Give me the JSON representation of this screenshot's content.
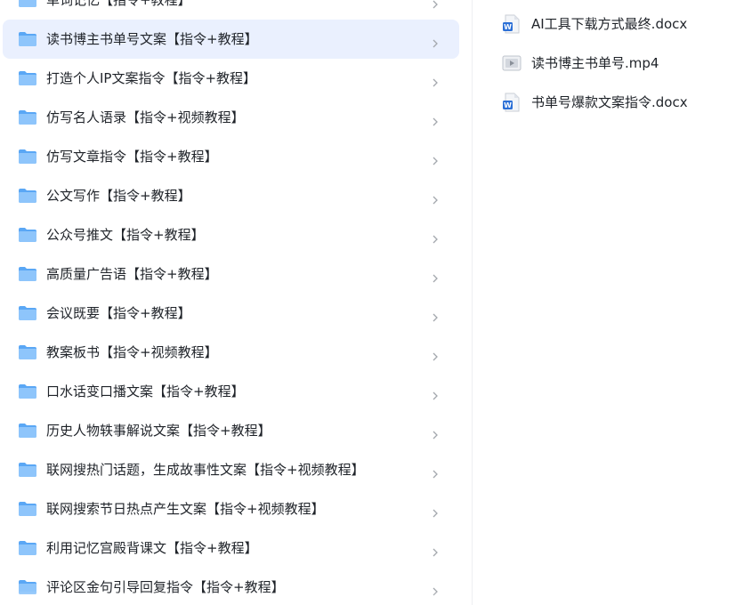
{
  "folders": [
    {
      "label": "单词记忆【指令+教程】"
    },
    {
      "label": "读书博主书单号文案【指令+教程】",
      "selected": true
    },
    {
      "label": "打造个人IP文案指令【指令+教程】"
    },
    {
      "label": "仿写名人语录【指令+视频教程】"
    },
    {
      "label": "仿写文章指令【指令+教程】"
    },
    {
      "label": "公文写作【指令+教程】"
    },
    {
      "label": "公众号推文【指令+教程】"
    },
    {
      "label": "高质量广告语【指令+教程】"
    },
    {
      "label": "会议既要【指令+教程】"
    },
    {
      "label": "教案板书【指令+视频教程】"
    },
    {
      "label": "口水话变口播文案【指令+教程】"
    },
    {
      "label": "历史人物轶事解说文案【指令+教程】"
    },
    {
      "label": "联网搜热门话题，生成故事性文案【指令+视频教程】"
    },
    {
      "label": "联网搜索节日热点产生文案【指令+视频教程】"
    },
    {
      "label": "利用记忆宫殿背课文【指令+教程】"
    },
    {
      "label": "评论区金句引导回复指令【指令+教程】"
    }
  ],
  "files": [
    {
      "label": "AI工具下载方式最终.docx",
      "icon": "word-doc-icon"
    },
    {
      "label": "读书博主书单号.mp4",
      "icon": "video-file-icon"
    },
    {
      "label": "书单号爆款文案指令.docx",
      "icon": "word-doc-icon"
    }
  ],
  "colors": {
    "folder": "#5aa7f5",
    "folder_light": "#8ec5fb",
    "selected_bg": "#eaf0fe",
    "text": "#1f2329",
    "chevron": "#a3a7ad",
    "word_blue": "#2b6fd6"
  }
}
